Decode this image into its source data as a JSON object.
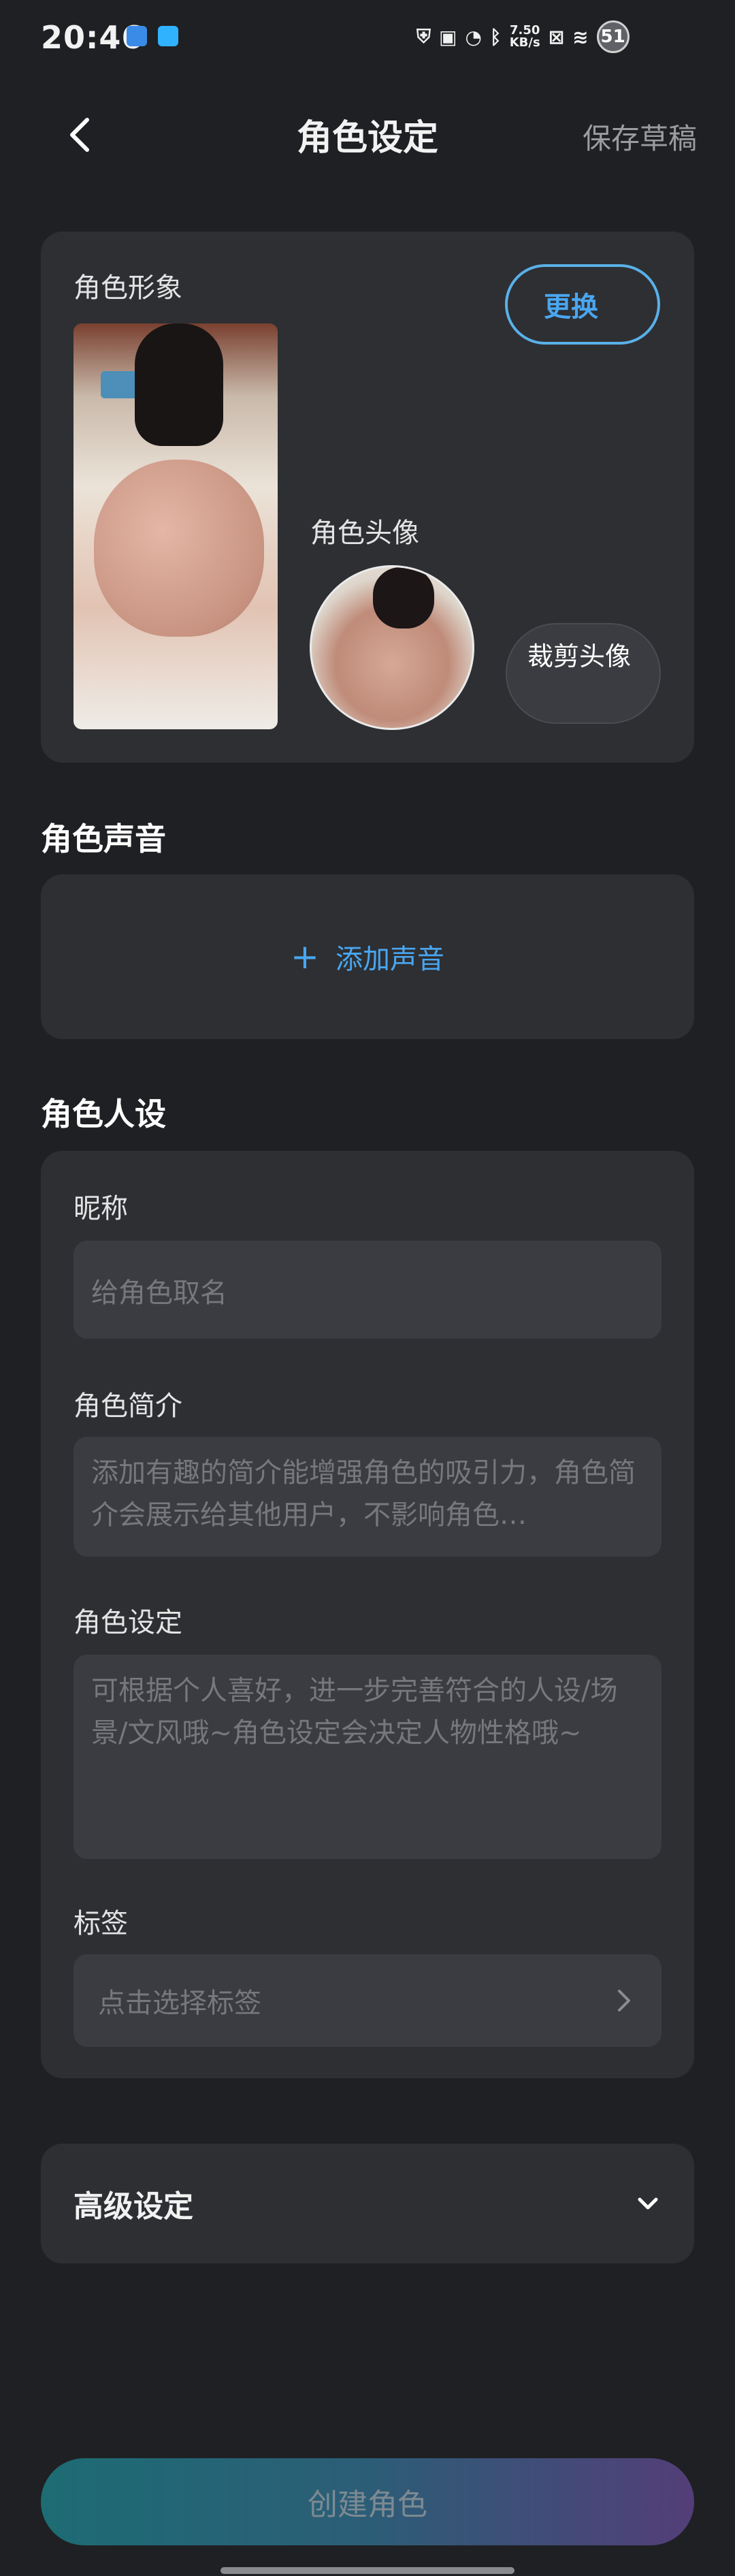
{
  "status_bar": {
    "time": "20:46",
    "net_speed_top": "7.50",
    "net_speed_bottom": "KB/s",
    "battery": "51"
  },
  "header": {
    "title": "角色设定",
    "save_draft": "保存草稿"
  },
  "image_section": {
    "label": "角色形象",
    "replace_button": "更换",
    "head_label": "角色头像",
    "crop_button": "裁剪头像"
  },
  "voice_section": {
    "title": "角色声音",
    "add_label": "添加声音"
  },
  "persona_section": {
    "title": "角色人设",
    "nickname_label": "昵称",
    "nickname_placeholder": "给角色取名",
    "intro_label": "角色简介",
    "intro_placeholder": "添加有趣的简介能增强角色的吸引力，角色简介会展示给其他用户，不影响角色…",
    "setting_label": "角色设定",
    "setting_placeholder": "可根据个人喜好，进一步完善符合的人设/场景/文风哦~角色设定会决定人物性格哦~",
    "tags_label": "标签",
    "tags_placeholder": "点击选择标签"
  },
  "advanced": {
    "label": "高级设定"
  },
  "footer": {
    "create_button": "创建角色"
  }
}
